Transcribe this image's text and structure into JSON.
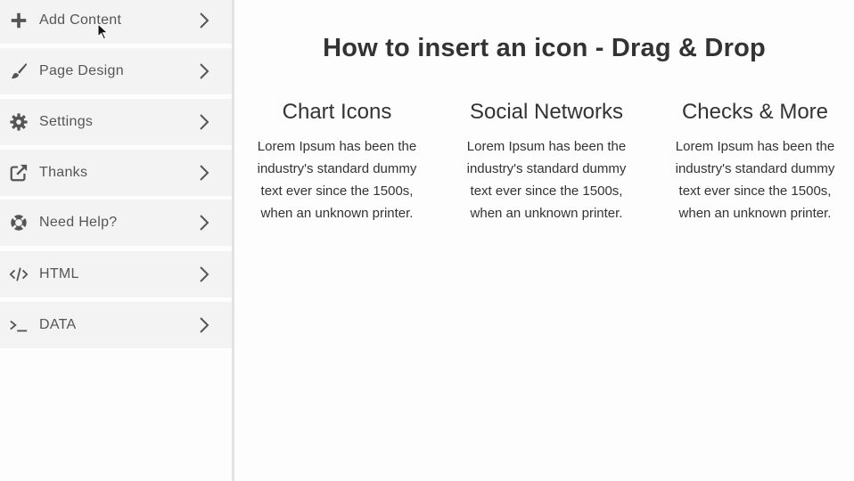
{
  "sidebar": {
    "items": [
      {
        "label": "Add Content",
        "icon": "plus-icon"
      },
      {
        "label": "Page Design",
        "icon": "brush-icon"
      },
      {
        "label": "Settings",
        "icon": "gear-icon"
      },
      {
        "label": "Thanks",
        "icon": "external-link-icon"
      },
      {
        "label": "Need Help?",
        "icon": "lifebuoy-icon"
      },
      {
        "label": "HTML",
        "icon": "code-icon"
      },
      {
        "label": "DATA",
        "icon": "terminal-icon"
      }
    ]
  },
  "main": {
    "title": "How to insert an icon - Drag & Drop",
    "columns": [
      {
        "title": "Chart Icons",
        "text": "Lorem Ipsum has been the industry's standard dummy text ever since the 1500s, when an unknown printer."
      },
      {
        "title": "Social Networks",
        "text": "Lorem Ipsum has been the industry's standard dummy text ever since the 1500s, when an unknown printer."
      },
      {
        "title": "Checks & More",
        "text": "Lorem Ipsum has been the industry's standard dummy text ever since the 1500s, when an unknown printer."
      }
    ]
  },
  "colors": {
    "sidebar_item_bg": "#f3f3f3",
    "icon": "#555555",
    "text": "#333333"
  }
}
